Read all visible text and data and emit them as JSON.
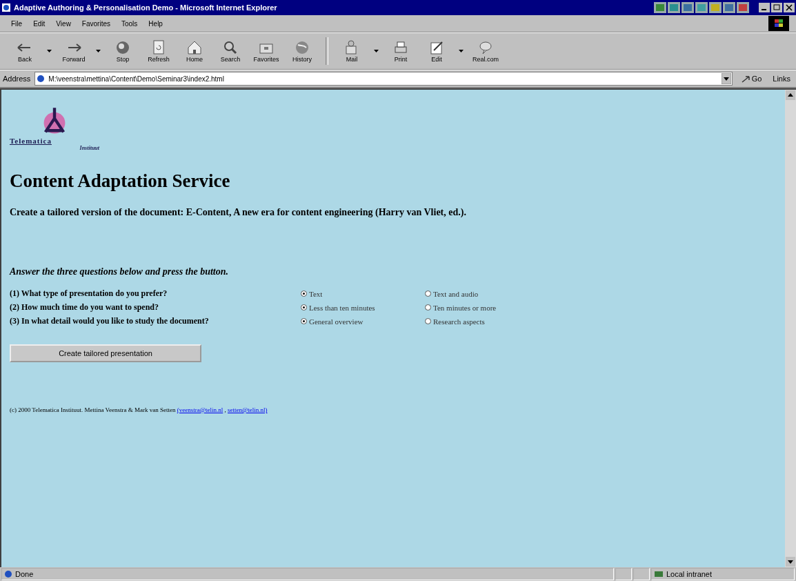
{
  "window": {
    "title": "Adaptive Authoring & Personalisation Demo - Microsoft Internet Explorer"
  },
  "menu": [
    "File",
    "Edit",
    "View",
    "Favorites",
    "Tools",
    "Help"
  ],
  "toolbar": [
    {
      "label": "Back",
      "dropdown": true
    },
    {
      "label": "Forward",
      "dropdown": true
    },
    {
      "label": "Stop",
      "dropdown": false
    },
    {
      "label": "Refresh",
      "dropdown": false
    },
    {
      "label": "Home",
      "dropdown": false
    },
    {
      "label": "Search",
      "dropdown": false
    },
    {
      "label": "Favorites",
      "dropdown": false
    },
    {
      "label": "History",
      "dropdown": false
    },
    {
      "label": "Mail",
      "dropdown": true
    },
    {
      "label": "Print",
      "dropdown": false
    },
    {
      "label": "Edit",
      "dropdown": true
    },
    {
      "label": "Real.com",
      "dropdown": false
    }
  ],
  "address_bar": {
    "label": "Address",
    "value": "M:\\veenstra\\mettina\\Content\\Demo\\Seminar3\\index2.html",
    "go": "Go",
    "links": "Links"
  },
  "page": {
    "logo": {
      "name": "Telematica",
      "subtitle": "Instituut"
    },
    "heading": "Content Adaptation Service",
    "intro": "Create a tailored version of the document: E-Content, A new era for content engineering (Harry van Vliet, ed.).",
    "instruction": "Answer the three questions below and press the button.",
    "questions": [
      {
        "label": "(1) What type of presentation do you prefer?",
        "options": [
          {
            "label": "Text",
            "selected": true
          },
          {
            "label": "Text and audio",
            "selected": false
          }
        ]
      },
      {
        "label": "(2) How much time do you want to spend?",
        "options": [
          {
            "label": "Less than ten minutes",
            "selected": true
          },
          {
            "label": "Ten minutes or more",
            "selected": false
          }
        ]
      },
      {
        "label": "(3) In what detail would you like to study the document?",
        "options": [
          {
            "label": "General overview",
            "selected": true
          },
          {
            "label": "Research aspects",
            "selected": false
          }
        ]
      }
    ],
    "button": "Create tailored presentation",
    "footer": [
      {
        "kind": "text",
        "text": "(c) 2000 Telematica Instituut. Mettina Veenstra & Mark van Setten "
      },
      {
        "kind": "link",
        "text": "(veenstra@telin.nl"
      },
      {
        "kind": "text",
        "text": " , "
      },
      {
        "kind": "link",
        "text": "setten@telin.nl)"
      }
    ]
  },
  "status_bar": {
    "text": "Done",
    "zone": "Local intranet"
  }
}
